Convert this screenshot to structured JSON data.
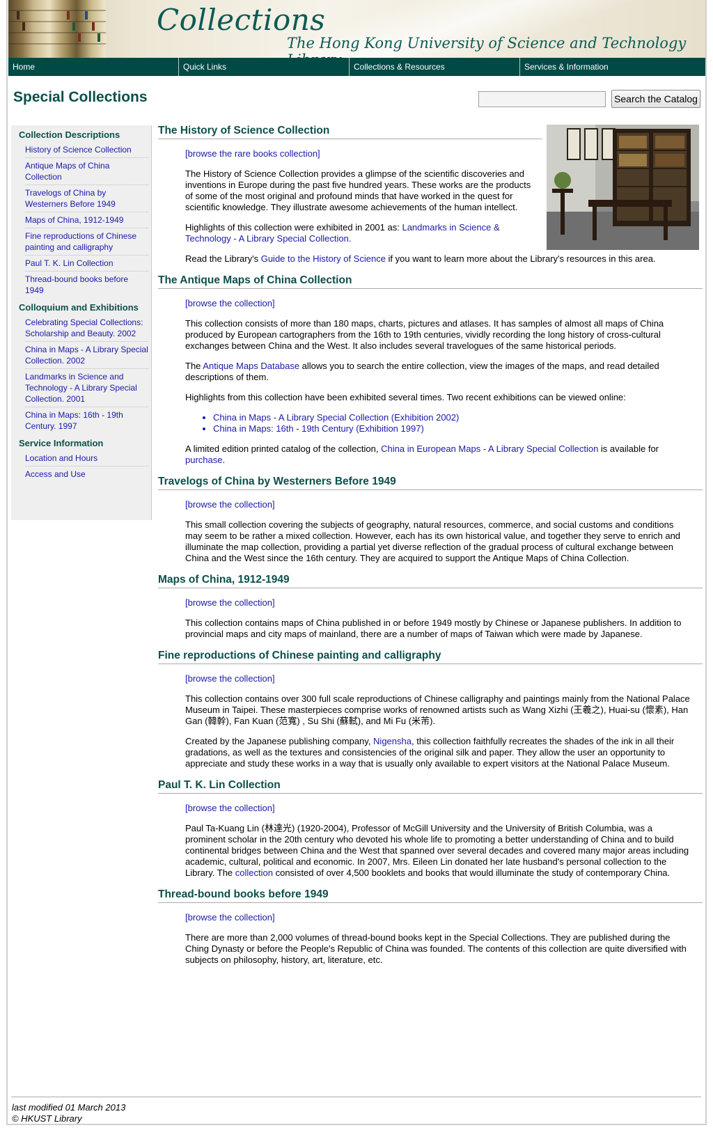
{
  "banner": {
    "title": "Collections",
    "subtitle": "The Hong Kong University of Science and Technology Library"
  },
  "nav": [
    {
      "label": "Home"
    },
    {
      "label": "Quick Links"
    },
    {
      "label": "Collections & Resources"
    },
    {
      "label": "Services & Information"
    }
  ],
  "page": {
    "title": "Special Collections"
  },
  "search": {
    "value": "",
    "placeholder": "",
    "button_label": "Search the Catalog"
  },
  "sidebar": {
    "groups": [
      {
        "heading": "Collection Descriptions",
        "items": [
          "History of Science Collection",
          "Antique Maps of China Collection",
          "Travelogs of China by Westerners Before 1949",
          "Maps of China, 1912-1949",
          "Fine reproductions of Chinese painting and calligraphy",
          "Paul T. K. Lin Collection",
          "Thread-bound books before 1949"
        ]
      },
      {
        "heading": "Colloquium and Exhibitions",
        "items": [
          "Celebrating Special Collections: Scholarship and Beauty. 2002",
          "China in Maps - A Library Special Collection. 2002",
          "Landmarks in Science and Technology - A Library Special Collection. 2001",
          "China in Maps: 16th - 19th Century. 1997"
        ]
      },
      {
        "heading": "Service Information",
        "items": [
          "Location and Hours",
          "Access and Use"
        ]
      }
    ]
  },
  "sections": {
    "hos": {
      "heading": "The History of Science Collection",
      "browse": "[browse the rare books collection]",
      "p1": "The History of Science Collection provides a glimpse of the scientific discoveries and inventions in Europe during the past five hundred years. These works are the products of some of the most original and profound minds that have worked in the quest for scientific knowledge. They illustrate awesome achievements of the human intellect.",
      "p2_pre": "Highlights of this collection were exhibited in 2001 as: ",
      "p2_link": "Landmarks in Science & Technology - A Library Special Collection.",
      "p3_pre": "Read the Library's ",
      "p3_link": "Guide to the History of Science",
      "p3_post": " if you want to learn more about the Library's resources in this area."
    },
    "maps": {
      "heading": "The Antique Maps of China Collection",
      "browse": "[browse the collection]",
      "p1": "This collection consists of more than 180 maps, charts, pictures and atlases. It has samples of almost all maps of China produced by European cartographers from the 16th to 19th centuries, vividly recording the long history of cross-cultural exchanges between China and the West. It also includes several travelogues of the same historical periods.",
      "p2_pre": "The ",
      "p2_link": "Antique Maps Database",
      "p2_post": " allows you to search the entire collection, view the images of the maps, and read detailed descriptions of them.",
      "p3": "Highlights from this collection have been exhibited several times. Two recent exhibitions can be viewed online:",
      "exhibitions": [
        "China in Maps - A Library Special Collection (Exhibition 2002)",
        "China in Maps: 16th - 19th Century (Exhibition 1997)"
      ],
      "p4_pre": "A limited edition printed catalog of the collection, ",
      "p4_link": "China in European Maps - A Library Special Collection",
      "p4_mid": " is available for ",
      "p4_link2": "purchase",
      "p4_post": "."
    },
    "travel": {
      "heading": "Travelogs of China by Westerners Before 1949",
      "browse": "[browse the collection]",
      "p1": "This small collection covering the subjects of geography, natural resources, commerce, and social customs and conditions may seem to be rather a mixed collection. However, each has its own historical value, and together they serve to enrich and illuminate the map collection, providing a partial yet diverse reflection of the gradual process of cultural exchange between China and the West since the 16th century. They are acquired to support the Antique Maps of China Collection."
    },
    "moc": {
      "heading": "Maps of China, 1912-1949",
      "browse": "[browse the collection]",
      "p1": "This collection contains maps of China published in or before 1949 mostly by Chinese or Japanese publishers. In addition to provincial maps and city maps of mainland, there are a number of maps of Taiwan which were made by Japanese."
    },
    "fine": {
      "heading": "Fine reproductions of Chinese painting and calligraphy",
      "browse": "[browse the collection]",
      "p1": "This collection contains over 300 full scale reproductions of Chinese calligraphy and paintings mainly from the National Palace Museum in Taipei. These masterpieces comprise works of renowned artists such as Wang Xizhi (王羲之), Huai-su (懷素), Han Gan (韓幹), Fan Kuan (范寬) , Su Shi (蘇軾), and Mi Fu (米芾).",
      "p2_pre": "Created by the Japanese publishing company, ",
      "p2_link": "Nigensha",
      "p2_post": ", this collection faithfully recreates the shades of the ink in all their gradations, as well as the textures and consistencies of the original silk and paper. They allow the user an opportunity to appreciate and study these works in a way that is usually only available to expert visitors at the National Palace Museum."
    },
    "lin": {
      "heading": "Paul T. K. Lin Collection",
      "browse": "[browse the collection]",
      "p1_pre": "Paul Ta-Kuang Lin (林達光) (1920-2004), Professor of McGill University and the University of British Columbia, was a prominent scholar in the 20th century who devoted his whole life to promoting a better understanding of China and to build continental bridges between China and the West that spanned over several decades and covered many major areas including academic, cultural, political and economic. In 2007, Mrs. Eileen Lin donated her late husband's personal collection to the Library. The ",
      "p1_link": "collection",
      "p1_post": " consisted of over 4,500 booklets and books that would illuminate the study of contemporary China."
    },
    "thread": {
      "heading": "Thread-bound books before 1949",
      "browse": "[browse the collection]",
      "p1": "There are more than 2,000 volumes of thread-bound books kept in the Special Collections. They are published during the Ching Dynasty or before the People's Republic of China was founded. The contents of this collection are quite diversified with subjects on philosophy, history, art, literature, etc."
    }
  },
  "footer": {
    "modified": "last modified 01 March 2013",
    "copyright": "© HKUST Library"
  },
  "colors": {
    "nav_bg": "#004a45",
    "heading": "#0b4f4a",
    "link": "#1a1aa6",
    "sidebar_bg": "#efefef"
  }
}
